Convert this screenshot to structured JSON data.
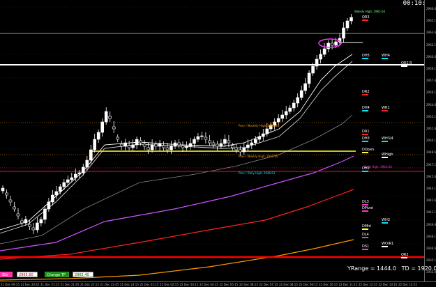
{
  "clock": "00:10:34",
  "y_axis_labels": [
    "2966.60",
    "2965.10",
    "2963.60",
    "2962.10",
    "2960.60",
    "2959.10",
    "2957.60",
    "2956.10",
    "2954.60",
    "2953.10",
    "2951.60",
    "2950.10",
    "2948.60",
    "2947.10",
    "2945.60",
    "2944.10",
    "2942.60",
    "2941.10",
    "2939.60",
    "2938.10",
    "2936.60",
    "2935.10",
    "2933.60"
  ],
  "x_axis_labels": [
    "21 Dec 09:15",
    "21 Dec 20:45",
    "21 Dec 21:15",
    "21 Dec 21:45",
    "21 Dec 22:15",
    "21 Dec 22:45",
    "21 Dec 23:15",
    "22 Dec 01:15",
    "22 Dec 02:15",
    "22 Dec 03:15",
    "22 Dec 04:15",
    "22 Dec 05:15",
    "22 Dec 06:15",
    "22 Dec 07:15",
    "22 Dec 08:15",
    "22 Dec 09:15",
    "22 Dec 10:15",
    "22 Dec 11:15",
    "22 Dec 12:15",
    "22 Dec 13:15",
    "22 Dec 14:15"
  ],
  "levels": [
    {
      "id": "qr3",
      "label": "QR3",
      "color": "#ff2020"
    },
    {
      "id": "dh5",
      "label": "DH5",
      "color": "#00e5ff"
    },
    {
      "id": "wh4",
      "label": "WH4",
      "color": "#00e5ff"
    },
    {
      "id": "qr23",
      "label": "QR2/3",
      "color": "#ffffff"
    },
    {
      "id": "dr2",
      "label": "DR2",
      "color": "#ff2020"
    },
    {
      "id": "dh4",
      "label": "DH4",
      "color": "#00e5ff"
    },
    {
      "id": "wr1",
      "label": "WR1",
      "color": "#ff2020"
    },
    {
      "id": "dr1",
      "label": "DR1",
      "color": "#ff2020"
    },
    {
      "id": "dh3",
      "label": "DH3",
      "color": "#00e5ff"
    },
    {
      "id": "wh34",
      "label": "WH3/4",
      "color": "#00e5ff"
    },
    {
      "id": "dopen",
      "label": "DOpen",
      "color": "#ffff33"
    },
    {
      "id": "whigh",
      "label": "WHigh",
      "color": "#ffffff"
    },
    {
      "id": "dh2",
      "label": "DH2",
      "color": "#00e5ff"
    },
    {
      "id": "dl3",
      "label": "DL3",
      "color": "#ff33cc"
    },
    {
      "id": "dpivot",
      "label": "DPivot",
      "color": "#ff33cc"
    },
    {
      "id": "wh3",
      "label": "WH3",
      "color": "#00e5ff"
    },
    {
      "id": "dmid",
      "label": "DMid",
      "color": "#ffff33"
    },
    {
      "id": "dl4",
      "label": "DL4",
      "color": "#ff33cc"
    },
    {
      "id": "ds1",
      "label": "DS1",
      "color": "#ff33cc"
    },
    {
      "id": "wowr1",
      "label": "WO/R1",
      "color": "#ffffff"
    },
    {
      "id": "qr2",
      "label": "QR2",
      "color": "#ffffff"
    }
  ],
  "notes": {
    "weekly_high": "Weekly High: 2965.64",
    "prev_monthly_high": "Prev / Monthly High: 2951.49",
    "prev_weekly_high": "Prev / Weekly High: 2947.40",
    "prev_daily_high": "Prev / Daily High: 2946.61",
    "daily_high": "Daily High: 2944.00"
  },
  "toolbar": {
    "slv_label": "SLV",
    "slv_value": "2965.60",
    "change_tp_label": "Change TP",
    "tp_value": "2965.40"
  },
  "stats": {
    "yrange": "YRange = 1444.0",
    "td": "TD = 1920.0"
  },
  "colors": {
    "background": "#000000",
    "grid": "#3a3a3a",
    "candle": "#ffffff",
    "ema_fast": "#ffffff",
    "ema_mid": "#cfcfcf",
    "ema_slow": "#888888",
    "ma_purple": "#cc55ff",
    "ma_red": "#ff2222",
    "ma_orange": "#ff9900",
    "line_red": "#ff0000",
    "line_yellow": "#ffff33"
  }
}
